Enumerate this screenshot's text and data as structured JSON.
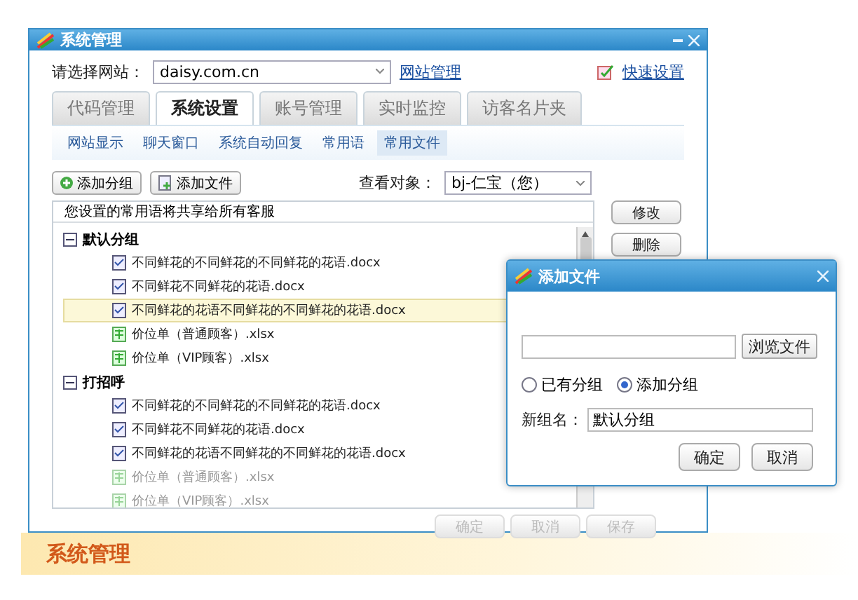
{
  "window": {
    "title": "系统管理"
  },
  "site": {
    "label": "请选择网站：",
    "value": "daisy.com.cn",
    "link": "网站管理"
  },
  "quick_settings": {
    "label": "快速设置"
  },
  "tabs": [
    {
      "label": "代码管理",
      "selected": false
    },
    {
      "label": "系统设置",
      "selected": true
    },
    {
      "label": "账号管理",
      "selected": false
    },
    {
      "label": "实时监控",
      "selected": false
    },
    {
      "label": "访客名片夹",
      "selected": false
    }
  ],
  "subtabs": [
    {
      "label": "网站显示",
      "selected": false
    },
    {
      "label": "聊天窗口",
      "selected": false
    },
    {
      "label": "系统自动回复",
      "selected": false
    },
    {
      "label": "常用语",
      "selected": false
    },
    {
      "label": "常用文件",
      "selected": true
    }
  ],
  "toolbar": [
    {
      "label": "添加分组",
      "kind": "add-group"
    },
    {
      "label": "添加文件",
      "kind": "add-file"
    }
  ],
  "view_target": {
    "label": "查看对象：",
    "value": "bj-仁宝（您）"
  },
  "list": {
    "header": "您设置的常用语将共享给所有客服",
    "groups": [
      {
        "label": "默认分组",
        "expanded": true,
        "children": [
          {
            "label": "不同鲜花的不同鲜花的不同鲜花的花语.docx",
            "kind": "doc",
            "selected": false,
            "dimmed": false
          },
          {
            "label": "不同鲜花不同鲜花的花语.docx",
            "kind": "doc",
            "selected": false,
            "dimmed": false
          },
          {
            "label": "不同鲜花的花语不同鲜花的不同鲜花的花语.docx",
            "kind": "doc",
            "selected": true,
            "dimmed": false
          },
          {
            "label": "价位单（普通顾客）.xlsx",
            "kind": "sheet",
            "selected": false,
            "dimmed": false
          },
          {
            "label": "价位单（VIP顾客）.xlsx",
            "kind": "sheet",
            "selected": false,
            "dimmed": false
          }
        ]
      },
      {
        "label": "打招呼",
        "expanded": true,
        "children": [
          {
            "label": "不同鲜花的不同鲜花的不同鲜花的花语.docx",
            "kind": "doc",
            "selected": false,
            "dimmed": false
          },
          {
            "label": "不同鲜花不同鲜花的花语.docx",
            "kind": "doc",
            "selected": false,
            "dimmed": false
          },
          {
            "label": "不同鲜花的花语不同鲜花的不同鲜花的花语.docx",
            "kind": "doc",
            "selected": false,
            "dimmed": false
          },
          {
            "label": "价位单（普通顾客）.xlsx",
            "kind": "sheet",
            "selected": false,
            "dimmed": true
          },
          {
            "label": "价位单（VIP顾客）.xlsx",
            "kind": "sheet",
            "selected": false,
            "dimmed": true
          }
        ]
      }
    ]
  },
  "side_buttons": [
    "修改",
    "删除"
  ],
  "footer_buttons": [
    {
      "label": "确定",
      "disabled": true
    },
    {
      "label": "取消",
      "disabled": true
    },
    {
      "label": "保存",
      "disabled": true
    }
  ],
  "dialog": {
    "title": "添加文件",
    "browse": "浏览文件",
    "options": [
      {
        "label": "已有分组",
        "selected": false
      },
      {
        "label": "添加分组",
        "selected": true
      }
    ],
    "name_label": "新组名：",
    "name_value": "默认分组",
    "buttons": [
      "确定",
      "取消"
    ]
  },
  "banner": {
    "title": "系统管理"
  }
}
